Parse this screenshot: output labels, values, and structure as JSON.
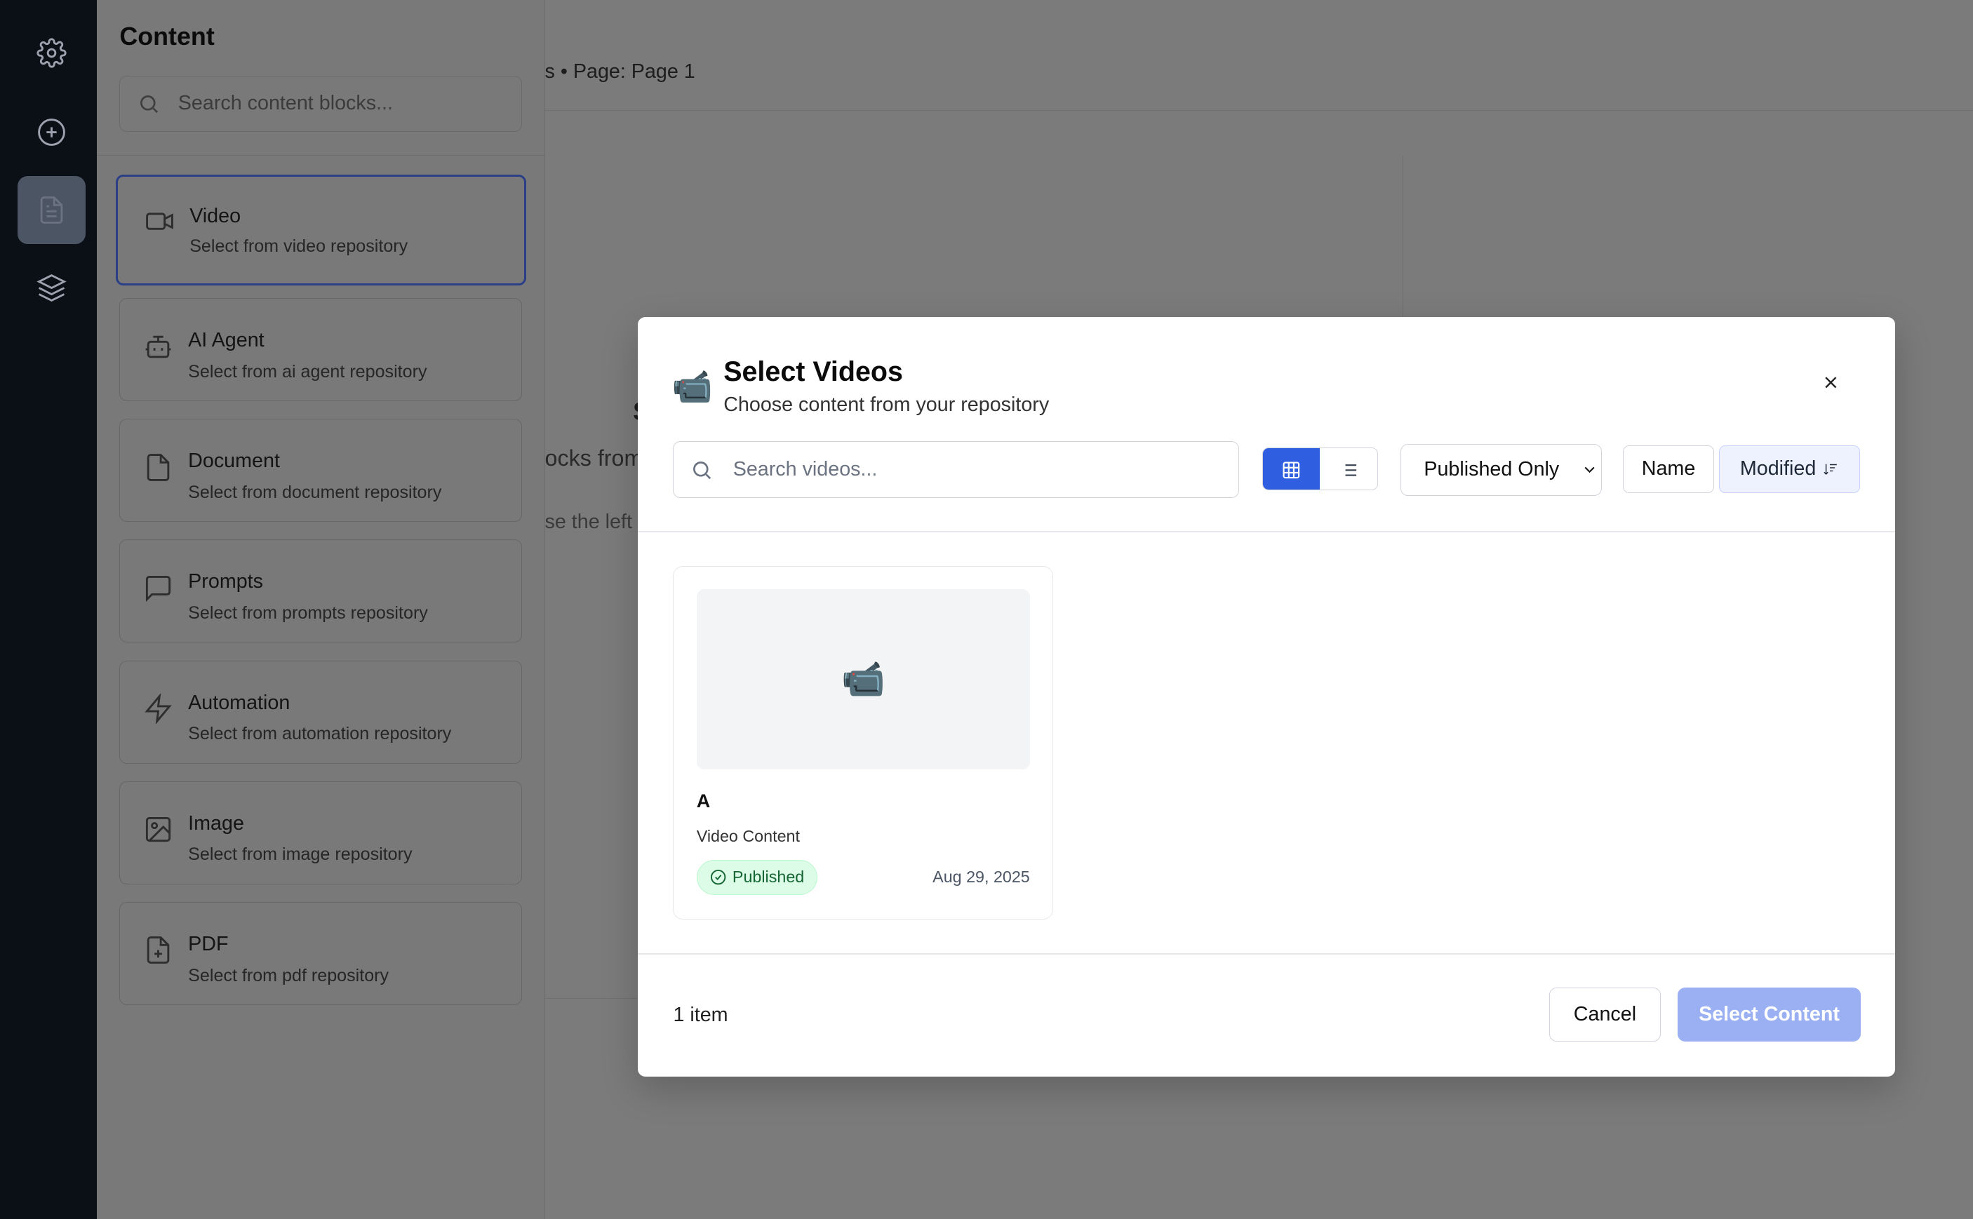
{
  "panel": {
    "title": "Content",
    "search_placeholder": "Search content blocks...",
    "blocks": [
      {
        "title": "Video",
        "desc": "Select from video repository",
        "icon": "video-icon"
      },
      {
        "title": "AI Agent",
        "desc": "Select from ai agent repository",
        "icon": "bot-icon"
      },
      {
        "title": "Document",
        "desc": "Select from document repository",
        "icon": "document-icon"
      },
      {
        "title": "Prompts",
        "desc": "Select from prompts repository",
        "icon": "chat-icon"
      },
      {
        "title": "Automation",
        "desc": "Select from automation repository",
        "icon": "lightning-icon"
      },
      {
        "title": "Image",
        "desc": "Select from image repository",
        "icon": "image-icon"
      },
      {
        "title": "PDF",
        "desc": "Select from pdf repository",
        "icon": "file-plus-icon"
      }
    ]
  },
  "background": {
    "breadcrumb": "s • Page: Page 1",
    "partial_heading": "S",
    "partial_text1": "ocks from",
    "partial_text2": "se the left s"
  },
  "modal": {
    "icon": "📹",
    "title": "Select Videos",
    "subtitle": "Choose content from your repository",
    "search_placeholder": "Search videos...",
    "filter_value": "Published Only",
    "sort_name": "Name",
    "sort_modified": "Modified",
    "items": [
      {
        "icon": "📹",
        "title": "A",
        "type": "Video Content",
        "status": "Published",
        "date": "Aug 29, 2025"
      }
    ],
    "count_text": "1 item",
    "cancel_label": "Cancel",
    "select_label": "Select Content"
  },
  "colors": {
    "accent": "#2f5fe0",
    "select_disabled": "#9bb0f3",
    "published_bg": "#dcfce7",
    "published_text": "#166534",
    "rail_bg": "#0b0f16"
  }
}
